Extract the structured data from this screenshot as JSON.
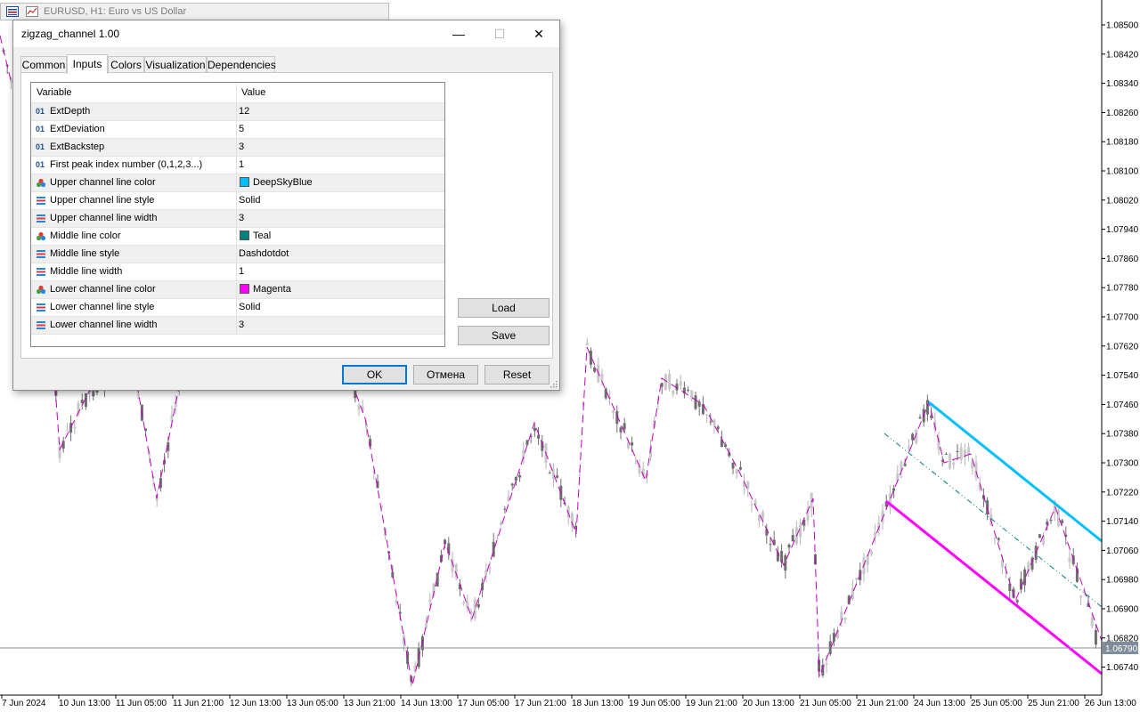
{
  "window": {
    "title": "EURUSD, H1:  Euro vs US Dollar",
    "icon": "chart-window-icon"
  },
  "dialog": {
    "title": "zigzag_channel 1.00",
    "controls": {
      "minimize": "—",
      "maximize": "☐",
      "close": "✕"
    },
    "tabs": [
      {
        "label": "Common",
        "active": false
      },
      {
        "label": "Inputs",
        "active": true
      },
      {
        "label": "Colors",
        "active": false
      },
      {
        "label": "Visualization",
        "active": false
      },
      {
        "label": "Dependencies",
        "active": false
      }
    ],
    "table": {
      "headers": {
        "variable": "Variable",
        "value": "Value"
      },
      "rows": [
        {
          "icon": "int",
          "name": "ExtDepth",
          "value": "12"
        },
        {
          "icon": "int",
          "name": "ExtDeviation",
          "value": "5"
        },
        {
          "icon": "int",
          "name": "ExtBackstep",
          "value": "3"
        },
        {
          "icon": "int",
          "name": "First peak index number (0,1,2,3...)",
          "value": "1"
        },
        {
          "icon": "color",
          "name": "Upper channel line color",
          "value": "DeepSkyBlue",
          "swatch": "#00bfff"
        },
        {
          "icon": "enum",
          "name": "Upper channel line style",
          "value": "Solid"
        },
        {
          "icon": "enum",
          "name": "Upper channel line width",
          "value": "3"
        },
        {
          "icon": "color",
          "name": "Middle line color",
          "value": "Teal",
          "swatch": "#008080"
        },
        {
          "icon": "enum",
          "name": "Middle line style",
          "value": "Dashdotdot"
        },
        {
          "icon": "enum",
          "name": "Middle line width",
          "value": "1"
        },
        {
          "icon": "color",
          "name": "Lower channel line color",
          "value": "Magenta",
          "swatch": "#ff00ff"
        },
        {
          "icon": "enum",
          "name": "Lower channel line style",
          "value": "Solid"
        },
        {
          "icon": "enum",
          "name": "Lower channel line width",
          "value": "3"
        }
      ]
    },
    "buttons": {
      "load": "Load",
      "save": "Save",
      "ok": "OK",
      "cancel": "Отмена",
      "reset": "Reset"
    }
  },
  "chart": {
    "y_ticks": [
      "1.08500",
      "1.08420",
      "1.08340",
      "1.08260",
      "1.08180",
      "1.08100",
      "1.08020",
      "1.07940",
      "1.07860",
      "1.07780",
      "1.07700",
      "1.07620",
      "1.07540",
      "1.07460",
      "1.07380",
      "1.07300",
      "1.07220",
      "1.07140",
      "1.07060",
      "1.06980",
      "1.06900",
      "1.06820",
      "1.06740"
    ],
    "current_price": "1.06790",
    "x_ticks": [
      "7 Jun 2024",
      "10 Jun 13:00",
      "11 Jun 05:00",
      "11 Jun 21:00",
      "12 Jun 13:00",
      "13 Jun 05:00",
      "13 Jun 21:00",
      "14 Jun 13:00",
      "17 Jun 05:00",
      "17 Jun 21:00",
      "18 Jun 13:00",
      "19 Jun 05:00",
      "19 Jun 21:00",
      "20 Jun 13:00",
      "21 Jun 05:00",
      "21 Jun 21:00",
      "24 Jun 13:00",
      "25 Jun 05:00",
      "25 Jun 21:00",
      "26 Jun 13:00"
    ],
    "colors": {
      "zigzag": "#c000c0",
      "upper": "#00bfff",
      "middle": "#008080",
      "lower": "#ff00ff",
      "candle": "#8c8c8c",
      "price_line": "#7f8c99"
    }
  }
}
